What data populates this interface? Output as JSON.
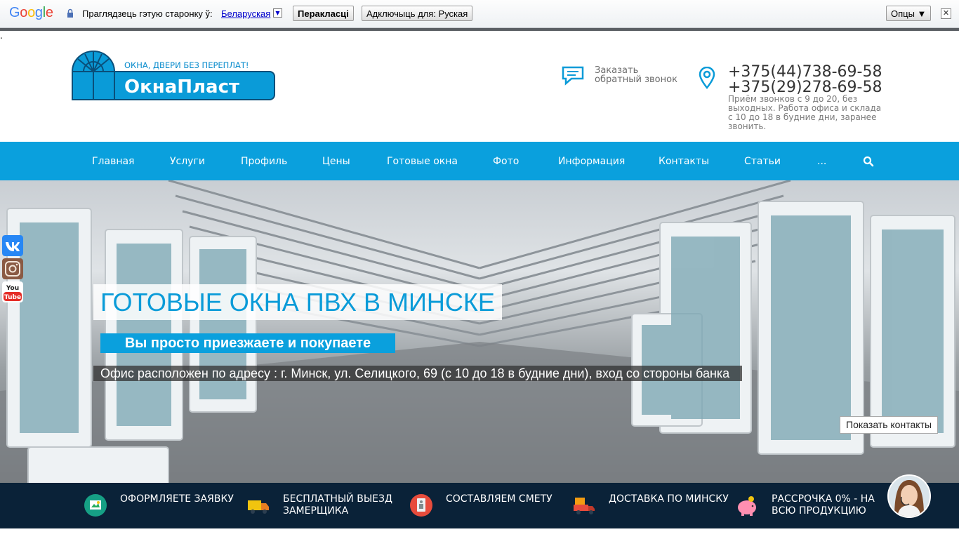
{
  "translate_bar": {
    "logo": "Google",
    "prompt": "Праглядзець гэтую старонку ў:",
    "language": "Беларуская",
    "translate_button": "Перакласці",
    "disable_button": "Адключыць для: Руская",
    "options_button": "Опцы ▼",
    "close": "✕"
  },
  "stray_dot": ".",
  "header": {
    "logo_tagline": "ОКНА, ДВЕРИ БЕЗ ПЕРЕПЛАТ!",
    "logo_name": "ОкнаПласт",
    "callback_line1": "Заказать",
    "callback_line2": "обратный звонок",
    "phone1": "+375(44)738-69-58",
    "phone2": "+375(29)278-69-58",
    "hours": "Приём звонков с 9 до 20, без выходных. Работа офиса и склада с 10 до 18 в будние дни, заранее звонить."
  },
  "nav": {
    "items": [
      "Главная",
      "Услуги",
      "Профиль",
      "Цены",
      "Готовые окна",
      "Фото",
      "Информация",
      "Контакты",
      "Статьи",
      "..."
    ]
  },
  "hero": {
    "title": "ГОТОВЫЕ ОКНА ПВХ В МИНСКЕ",
    "subtitle": "Вы просто приезжаете и покупаете",
    "address": "Офис расположен по адресу : г. Минск, ул. Селицкого, 69 (с 10 до 18 в будние дни), вход со стороны банка",
    "show_contacts": "Показать контакты"
  },
  "features": [
    {
      "text": "ОФОРМЛЯЕТЕ ЗАЯВКУ",
      "icon": "application-icon"
    },
    {
      "text": "БЕСПЛАТНЫЙ ВЫЕЗД ЗАМЕРЩИКА",
      "icon": "truck-icon"
    },
    {
      "text": "СОСТАВЛЯЕМ СМЕТУ",
      "icon": "estimate-icon"
    },
    {
      "text": "ДОСТАВКА ПО МИНСКУ",
      "icon": "delivery-icon"
    },
    {
      "text": "РАССРОЧКА 0% - НА ВСЮ ПРОДУКЦИЮ",
      "icon": "piggy-bank-icon"
    }
  ],
  "social": [
    "vk-icon",
    "instagram-icon",
    "youtube-icon"
  ],
  "colors": {
    "accent": "#0aa0dd",
    "footer_band": "#0a2238",
    "logo_blue": "#0a9bd8"
  }
}
